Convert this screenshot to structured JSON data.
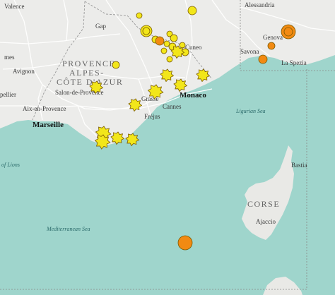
{
  "map": {
    "colors": {
      "land": "#ececea",
      "sea": "#9fd5cc",
      "sea_deep": "#7fc8bf",
      "road": "#ffffff",
      "quake_yellow": "#f2e61a",
      "quake_orange": "#f28a12",
      "quake_stroke": "#7a5a00"
    },
    "labels": {
      "valence": "Valence",
      "gap": "Gap",
      "cuneo": "Cuneo",
      "alessandria": "Alessandria",
      "genova": "Genova",
      "savona": "Savona",
      "la_spezia": "La Spezia",
      "avignon": "Avignon",
      "mes": "mes",
      "pellier": "pellier",
      "salon": "Salon-de-Provence",
      "aix": "Aix-en-Provence",
      "marseille": "Marseille",
      "grasse": "Grasse",
      "cannes": "Cannes",
      "frejus": "Fréjus",
      "monaco": "Monaco",
      "bastia": "Bastia",
      "ajaccio": "Ajaccio",
      "corse": "CORSE",
      "region_l1": "PROVENCE-",
      "region_l2": "ALPES-",
      "region_l3": "CÔTE D'AZUR",
      "ligurian_sea": "Ligurian Sea",
      "med_sea": "Mediterranean Sea",
      "lions": "of Lions"
    },
    "icons": {
      "earthquake_circle": "earthquake-circle-marker",
      "earthquake_star": "earthquake-star-marker"
    }
  }
}
